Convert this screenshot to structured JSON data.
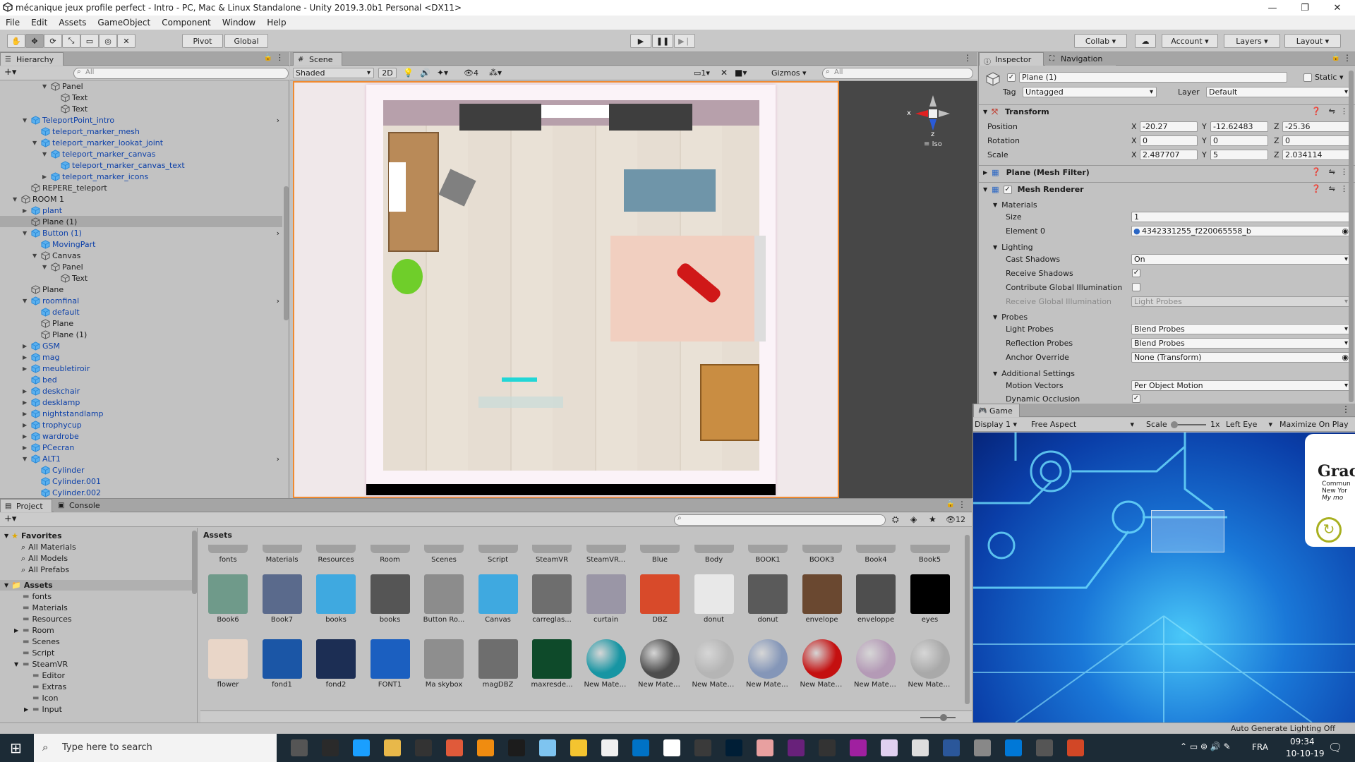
{
  "window": {
    "title": "mécanique jeux profile perfect - Intro - PC, Mac & Linux Standalone - Unity 2019.3.0b1 Personal <DX11>",
    "minimize": "—",
    "maximize": "❐",
    "close": "✕"
  },
  "menu": [
    "File",
    "Edit",
    "Assets",
    "GameObject",
    "Component",
    "Window",
    "Help"
  ],
  "toolbar": {
    "pivot": "Pivot",
    "global": "Global",
    "collab": "Collab",
    "account": "Account",
    "layers": "Layers",
    "layout": "Layout"
  },
  "hierarchy": {
    "tab": "Hierarchy",
    "search_placeholder": "All",
    "items": [
      {
        "label": "Panel",
        "indent": 4,
        "arrow": "▼",
        "prefab": false
      },
      {
        "label": "Text",
        "indent": 5,
        "arrow": "",
        "prefab": false
      },
      {
        "label": "Text",
        "indent": 5,
        "arrow": "",
        "prefab": false
      },
      {
        "label": "TeleportPoint_intro",
        "indent": 2,
        "arrow": "▼",
        "prefab": true
      },
      {
        "label": "teleport_marker_mesh",
        "indent": 3,
        "arrow": "",
        "prefab": true
      },
      {
        "label": "teleport_marker_lookat_joint",
        "indent": 3,
        "arrow": "▼",
        "prefab": true
      },
      {
        "label": "teleport_marker_canvas",
        "indent": 4,
        "arrow": "▼",
        "prefab": true
      },
      {
        "label": "teleport_marker_canvas_text",
        "indent": 5,
        "arrow": "",
        "prefab": true
      },
      {
        "label": "teleport_marker_icons",
        "indent": 4,
        "arrow": "▶",
        "prefab": true
      },
      {
        "label": "REPERE_teleport",
        "indent": 2,
        "arrow": "",
        "prefab": false
      },
      {
        "label": "ROOM 1",
        "indent": 1,
        "arrow": "▼",
        "prefab": false
      },
      {
        "label": "plant",
        "indent": 2,
        "arrow": "▶",
        "prefab": true
      },
      {
        "label": "Plane (1)",
        "indent": 2,
        "arrow": "",
        "prefab": false,
        "selected": true
      },
      {
        "label": "Button (1)",
        "indent": 2,
        "arrow": "▼",
        "prefab": true
      },
      {
        "label": "MovingPart",
        "indent": 3,
        "arrow": "",
        "prefab": true
      },
      {
        "label": "Canvas",
        "indent": 3,
        "arrow": "▼",
        "prefab": false
      },
      {
        "label": "Panel",
        "indent": 4,
        "arrow": "▼",
        "prefab": false
      },
      {
        "label": "Text",
        "indent": 5,
        "arrow": "",
        "prefab": false
      },
      {
        "label": "Plane",
        "indent": 2,
        "arrow": "",
        "prefab": false
      },
      {
        "label": "roomfinal",
        "indent": 2,
        "arrow": "▼",
        "prefab": true
      },
      {
        "label": "default",
        "indent": 3,
        "arrow": "",
        "prefab": true
      },
      {
        "label": "Plane",
        "indent": 3,
        "arrow": "",
        "prefab": false
      },
      {
        "label": "Plane (1)",
        "indent": 3,
        "arrow": "",
        "prefab": false
      },
      {
        "label": "GSM",
        "indent": 2,
        "arrow": "▶",
        "prefab": true
      },
      {
        "label": "mag",
        "indent": 2,
        "arrow": "▶",
        "prefab": true
      },
      {
        "label": "meubletiroir",
        "indent": 2,
        "arrow": "▶",
        "prefab": true
      },
      {
        "label": "bed",
        "indent": 2,
        "arrow": "",
        "prefab": true
      },
      {
        "label": "deskchair",
        "indent": 2,
        "arrow": "▶",
        "prefab": true
      },
      {
        "label": "desklamp",
        "indent": 2,
        "arrow": "▶",
        "prefab": true
      },
      {
        "label": "nightstandlamp",
        "indent": 2,
        "arrow": "▶",
        "prefab": true
      },
      {
        "label": "trophycup",
        "indent": 2,
        "arrow": "▶",
        "prefab": true
      },
      {
        "label": "wardrobe",
        "indent": 2,
        "arrow": "▶",
        "prefab": true
      },
      {
        "label": "PCecran",
        "indent": 2,
        "arrow": "▶",
        "prefab": true
      },
      {
        "label": "ALT1",
        "indent": 2,
        "arrow": "▼",
        "prefab": true
      },
      {
        "label": "Cylinder",
        "indent": 3,
        "arrow": "",
        "prefab": true
      },
      {
        "label": "Cylinder.001",
        "indent": 3,
        "arrow": "",
        "prefab": true
      },
      {
        "label": "Cylinder.002",
        "indent": 3,
        "arrow": "",
        "prefab": true
      }
    ]
  },
  "scene": {
    "tab": "Scene",
    "shading": "Shaded",
    "mode_2d": "2D",
    "hidden_count": "4",
    "camera_count": "1",
    "gizmos": "Gizmos",
    "search_placeholder": "All",
    "iso_label": "Iso",
    "axis_x": "x",
    "axis_z": "z"
  },
  "inspector": {
    "tab": "Inspector",
    "tab2": "Navigation",
    "object_name": "Plane (1)",
    "static_label": "Static",
    "tag_label": "Tag",
    "tag_value": "Untagged",
    "layer_label": "Layer",
    "layer_value": "Default",
    "transform": {
      "title": "Transform",
      "position_label": "Position",
      "rotation_label": "Rotation",
      "scale_label": "Scale",
      "position": {
        "x": "-20.27",
        "y": "-12.62483",
        "z": "-25.36"
      },
      "rotation": {
        "x": "0",
        "y": "0",
        "z": "0"
      },
      "scale": {
        "x": "2.487707",
        "y": "5",
        "z": "2.034114"
      }
    },
    "mesh_filter_title": "Plane (Mesh Filter)",
    "mesh_renderer": {
      "title": "Mesh Renderer",
      "materials_label": "Materials",
      "size_label": "Size",
      "size_value": "1",
      "element0_label": "Element 0",
      "element0_value": "4342331255_f220065558_b",
      "lighting_label": "Lighting",
      "cast_shadows_label": "Cast Shadows",
      "cast_shadows_value": "On",
      "receive_shadows_label": "Receive Shadows",
      "contribute_gi_label": "Contribute Global Illumination",
      "receive_gi_label": "Receive Global Illumination",
      "receive_gi_value": "Light Probes",
      "probes_label": "Probes",
      "light_probes_label": "Light Probes",
      "light_probes_value": "Blend Probes",
      "reflection_probes_label": "Reflection Probes",
      "reflection_probes_value": "Blend Probes",
      "anchor_override_label": "Anchor Override",
      "anchor_override_value": "None (Transform)",
      "additional_label": "Additional Settings",
      "motion_vectors_label": "Motion Vectors",
      "motion_vectors_value": "Per Object Motion",
      "dynamic_occlusion_label": "Dynamic Occlusion"
    }
  },
  "game": {
    "tab": "Game",
    "display": "Display 1",
    "aspect": "Free Aspect",
    "scale_label": "Scale",
    "scale_value": "1x",
    "eye": "Left Eye",
    "maximize": "Maximize On Play",
    "overlay_text_1": "Grac",
    "overlay_text_2": "Commun",
    "overlay_text_3": "New Yor",
    "overlay_text_4": "My mo"
  },
  "project": {
    "tab": "Project",
    "tab2": "Console",
    "hidden_count": "12",
    "favorites_label": "Favorites",
    "favorites": [
      "All Materials",
      "All Models",
      "All Prefabs"
    ],
    "assets_label": "Assets",
    "breadcrumb": "Assets",
    "folders": [
      {
        "label": "fonts",
        "indent": 1,
        "arrow": ""
      },
      {
        "label": "Materials",
        "indent": 1,
        "arrow": ""
      },
      {
        "label": "Resources",
        "indent": 1,
        "arrow": ""
      },
      {
        "label": "Room",
        "indent": 1,
        "arrow": "▶"
      },
      {
        "label": "Scenes",
        "indent": 1,
        "arrow": ""
      },
      {
        "label": "Script",
        "indent": 1,
        "arrow": ""
      },
      {
        "label": "SteamVR",
        "indent": 1,
        "arrow": "▼"
      },
      {
        "label": "Editor",
        "indent": 2,
        "arrow": ""
      },
      {
        "label": "Extras",
        "indent": 2,
        "arrow": ""
      },
      {
        "label": "Icon",
        "indent": 2,
        "arrow": ""
      },
      {
        "label": "Input",
        "indent": 2,
        "arrow": "▶"
      }
    ],
    "row1": [
      "fonts",
      "Materials",
      "Resources",
      "Room",
      "Scenes",
      "Script",
      "SteamVR",
      "SteamVR...",
      "Blue",
      "Body",
      "BOOK1",
      "BOOK3",
      "Book4",
      "Book5"
    ],
    "row2": [
      {
        "label": "Book6",
        "color": "#6f9a8a"
      },
      {
        "label": "Book7",
        "color": "#5a6a8c"
      },
      {
        "label": "books",
        "color": "#3fa9e0"
      },
      {
        "label": "books",
        "color": "#555555"
      },
      {
        "label": "Button Ro...",
        "color": "#8c8c8c"
      },
      {
        "label": "Canvas",
        "color": "#3fa9e0"
      },
      {
        "label": "carreglas...",
        "color": "#6e6e6e"
      },
      {
        "label": "curtain",
        "color": "#9a96a6"
      },
      {
        "label": "DBZ",
        "color": "#d84a2a"
      },
      {
        "label": "donut",
        "color": "#e8e8e8"
      },
      {
        "label": "donut",
        "color": "#5a5a5a"
      },
      {
        "label": "envelope",
        "color": "#6a4830"
      },
      {
        "label": "enveloppe",
        "color": "#4e4e4e"
      },
      {
        "label": "eyes",
        "color": "#000000"
      }
    ],
    "row3": [
      {
        "label": "flower",
        "color": "#e9d6c8"
      },
      {
        "label": "fond1",
        "color": "#1b56a6"
      },
      {
        "label": "fond2",
        "color": "#1c2e54"
      },
      {
        "label": "FONT1",
        "color": "#1b5fc0"
      },
      {
        "label": "Ma skybox",
        "color": "#8e8e8e"
      },
      {
        "label": "magDBZ",
        "color": "#6e6e6e"
      },
      {
        "label": "maxresde...",
        "color": "#0e4a2a"
      },
      {
        "label": "New Mater...",
        "color": "#1795a3"
      },
      {
        "label": "New Mater...",
        "color": "#4d4d4d"
      },
      {
        "label": "New Mater...",
        "color": "#b5b5b5"
      },
      {
        "label": "New Mater...",
        "color": "#8496b8"
      },
      {
        "label": "New Mater...",
        "color": "#c41010"
      },
      {
        "label": "New Mater...",
        "color": "#b49ab6"
      },
      {
        "label": "New Mater...",
        "color": "#a9a9a9"
      }
    ]
  },
  "status": {
    "right": "Auto Generate Lighting Off"
  },
  "taskbar": {
    "search_placeholder": "Type here to search",
    "lang": "FRA",
    "time": "09:34",
    "date": "10-10-19"
  }
}
